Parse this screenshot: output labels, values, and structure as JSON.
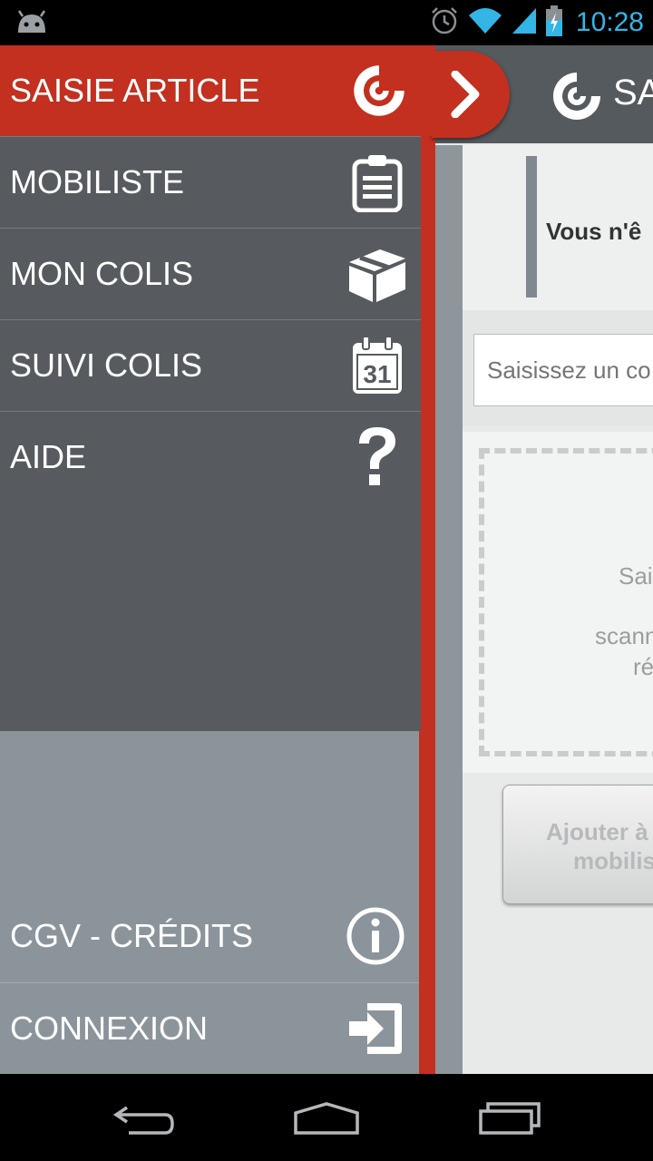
{
  "status_bar": {
    "time": "10:28",
    "icons": [
      "android-icon",
      "alarm-icon",
      "wifi-icon",
      "signal-icon",
      "battery-charging-icon"
    ]
  },
  "drawer": {
    "menu": [
      {
        "label": "SAISIE ARTICLE",
        "icon": "logo-swirl-icon",
        "active": true
      },
      {
        "label": "MOBILISTE",
        "icon": "clipboard-icon",
        "active": false
      },
      {
        "label": "MON COLIS",
        "icon": "package-box-icon",
        "active": false
      },
      {
        "label": "SUIVI COLIS",
        "icon": "calendar-icon",
        "active": false
      },
      {
        "label": "AIDE",
        "icon": "question-mark-icon",
        "active": false
      }
    ],
    "calendar_day": "31",
    "bottom_menu": [
      {
        "label": "CGV - CRÉDITS",
        "icon": "info-icon"
      },
      {
        "label": "CONNEXION",
        "icon": "login-arrow-icon"
      }
    ]
  },
  "app": {
    "title": "SA",
    "notice_text": "Vous n'ê",
    "search": {
      "placeholder": "Saisissez un co"
    },
    "drop_zone": {
      "line1": "Sai",
      "line2": "scann",
      "line3": "ré"
    },
    "add_button": {
      "line1": "Ajouter à",
      "line2": "mobilis"
    }
  },
  "colors": {
    "accent_red": "#c3301f",
    "drawer_bg": "#575b5f",
    "drawer_bottom_bg": "#8c949b",
    "status_time": "#33b5e5"
  },
  "nav_bar": {
    "buttons": [
      "back-icon",
      "home-icon",
      "recent-apps-icon"
    ]
  }
}
